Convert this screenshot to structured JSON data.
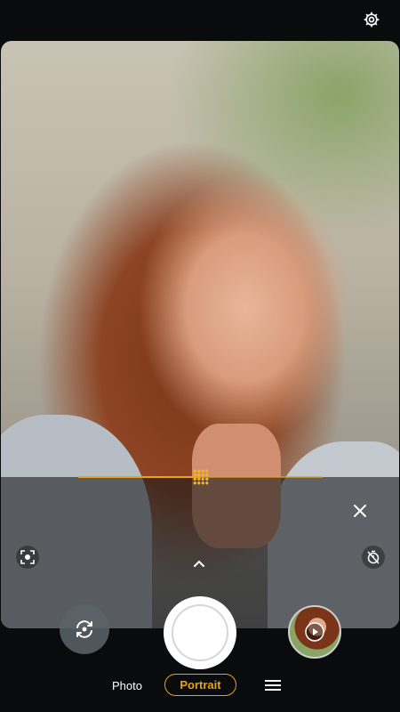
{
  "top_bar": {
    "settings_icon": "gear-icon"
  },
  "viewfinder": {
    "subject": "portrait-preview",
    "blur_slider": {
      "value": 0.5,
      "thumb_icon": "dot-grid-icon",
      "close_icon": "close-icon"
    },
    "left_icon": "face-scan-icon",
    "right_icon": "timer-off-icon",
    "expand_icon": "chevron-up-icon"
  },
  "controls": {
    "switch_camera_icon": "camera-switch-icon",
    "shutter_icon": "shutter-icon",
    "gallery_icon": "play-icon"
  },
  "modes": {
    "items": [
      {
        "label": "Photo",
        "active": false
      },
      {
        "label": "Portrait",
        "active": true
      }
    ],
    "menu_icon": "menu-icon"
  },
  "colors": {
    "accent": "#e8a317",
    "background": "#0a0b0d",
    "shutter": "#ffffff"
  }
}
